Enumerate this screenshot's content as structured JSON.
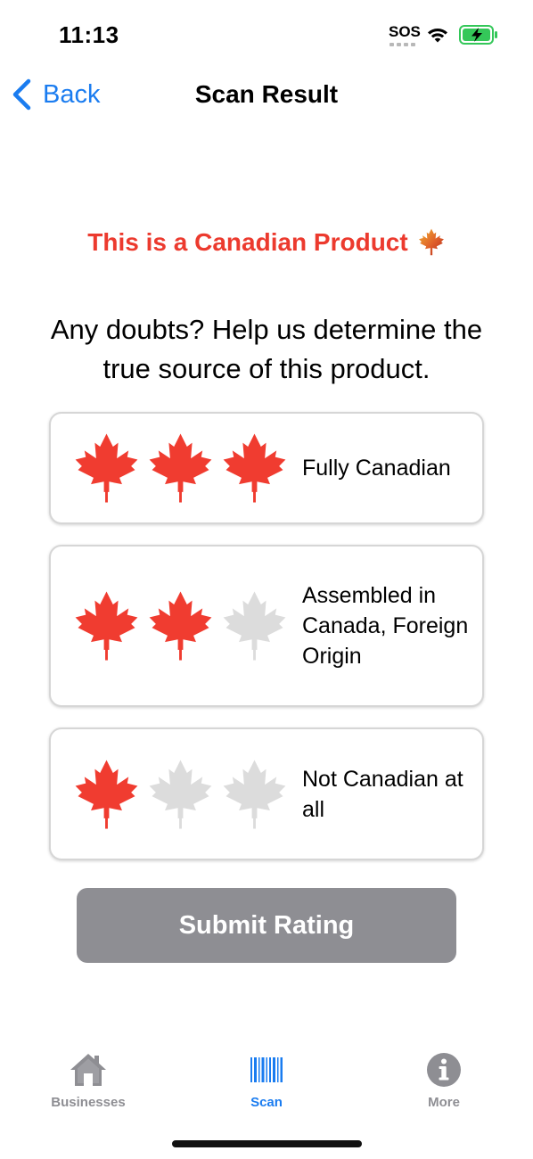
{
  "status_bar": {
    "time": "11:13",
    "sos": "SOS",
    "icons": [
      "wifi-icon",
      "battery-charging-icon"
    ],
    "battery_color": "#34c759"
  },
  "nav": {
    "back_label": "Back",
    "title": "Scan Result",
    "accent_color": "#1a7cf0"
  },
  "result": {
    "headline": "This is a Canadian Product",
    "headline_icon": "maple-leaf-emoji-icon",
    "headline_color": "#ec3a2e"
  },
  "prompt": "Any doubts? Help us determine the true source of this product.",
  "options": [
    {
      "label": "Fully Canadian",
      "rating": 3,
      "max": 3
    },
    {
      "label": "Assembled in Canada, Foreign Origin",
      "rating": 2,
      "max": 3
    },
    {
      "label": "Not Canadian at all",
      "rating": 1,
      "max": 3
    }
  ],
  "leaf_colors": {
    "active": "#f03c30",
    "inactive": "#dcdcdc"
  },
  "submit": {
    "label": "Submit Rating",
    "color": "#8e8e93"
  },
  "tabs": [
    {
      "label": "Businesses",
      "icon": "home-icon",
      "selected": false
    },
    {
      "label": "Scan",
      "icon": "barcode-icon",
      "selected": true
    },
    {
      "label": "More",
      "icon": "info-icon",
      "selected": false
    }
  ]
}
